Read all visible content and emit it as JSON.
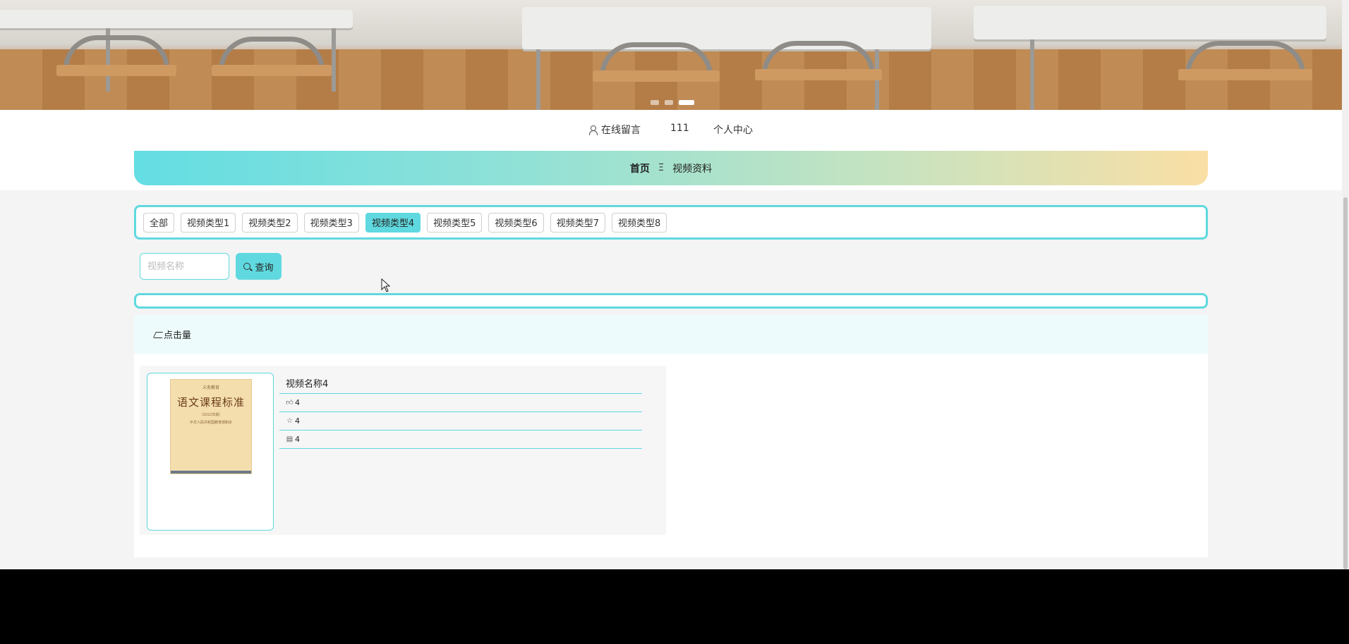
{
  "top_links": {
    "message": "在线留言",
    "user": "111",
    "profile": "个人中心"
  },
  "nav": {
    "home": "首页",
    "separator": "Ξ",
    "current": "视频资料"
  },
  "categories": [
    {
      "label": "全部",
      "active": false
    },
    {
      "label": "视频类型1",
      "active": false
    },
    {
      "label": "视频类型2",
      "active": false
    },
    {
      "label": "视频类型3",
      "active": false
    },
    {
      "label": "视频类型4",
      "active": true
    },
    {
      "label": "视频类型5",
      "active": false
    },
    {
      "label": "视频类型6",
      "active": false
    },
    {
      "label": "视频类型7",
      "active": false
    },
    {
      "label": "视频类型8",
      "active": false
    }
  ],
  "search": {
    "placeholder": "视频名称",
    "button_label": "查询"
  },
  "sort": {
    "label": "点击量"
  },
  "items": [
    {
      "name": "视频名称4",
      "likes": "4",
      "favorites": "4",
      "comments": "4",
      "cover": {
        "top": "义务教育",
        "title": "语文课程标准",
        "subtitle": "（2022年版）",
        "publisher": "中华人民共和国教育部制定"
      }
    }
  ],
  "colors": {
    "accent": "#5fd9df",
    "nav_start": "#63dde3",
    "nav_end": "#fadfa5"
  }
}
